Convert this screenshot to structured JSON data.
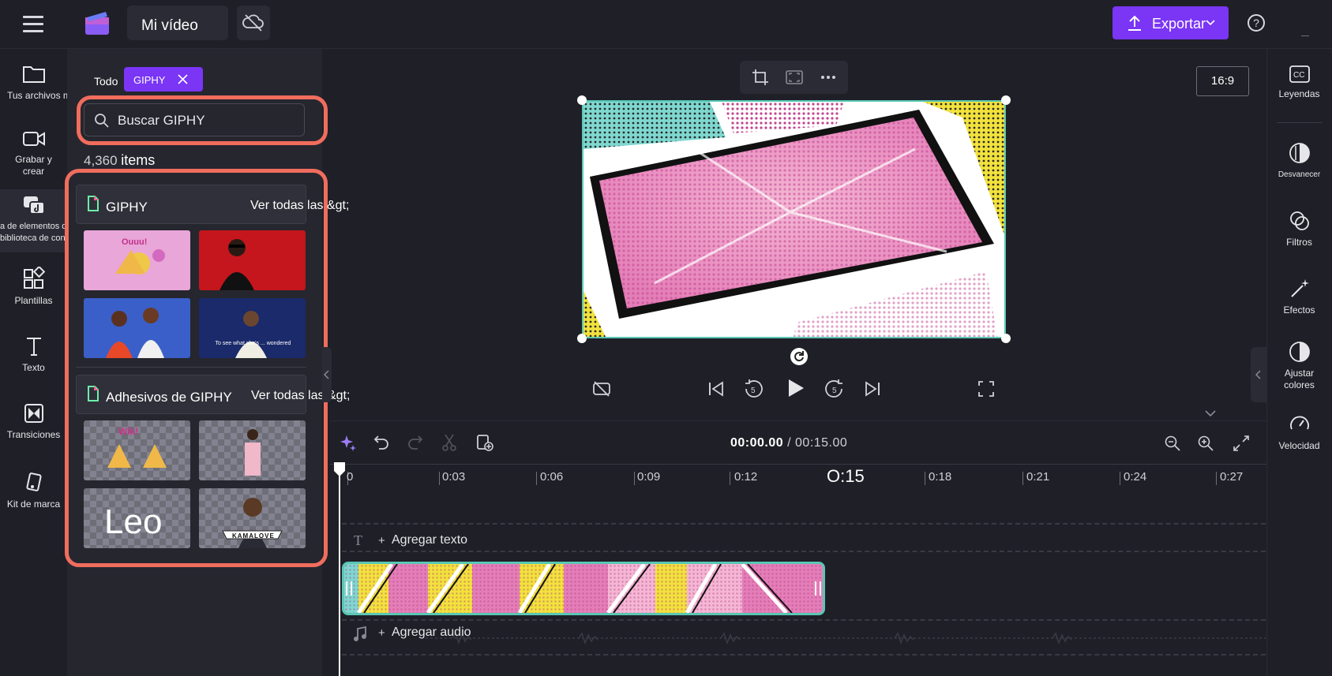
{
  "header": {
    "project_title": "Mi vídeo",
    "export_label": "Exportar",
    "help_label": "?"
  },
  "left_rail": {
    "items": [
      {
        "label": "Tus archivos multimedia",
        "icon": "folder-icon"
      },
      {
        "label": "Grabar y crear",
        "icon": "video-camera-icon"
      },
      {
        "label": "a de elementos de biblioteca de contenido",
        "icon": "content-library-icon"
      },
      {
        "label": "Plantillas",
        "icon": "templates-icon"
      },
      {
        "label": "Texto",
        "icon": "text-icon"
      },
      {
        "label": "Transiciones",
        "icon": "transitions-icon"
      },
      {
        "label": "Kit de marca",
        "icon": "brand-kit-icon"
      }
    ]
  },
  "panel": {
    "filter_all": "Todo",
    "filter_chip": "GIPHY",
    "search_placeholder": "Buscar GIPHY",
    "count_number": "4,360",
    "count_label": "items",
    "sections": [
      {
        "title": "GIPHY",
        "link": "Ver todas las &gt;"
      },
      {
        "title": "Adhesivos de GIPHY",
        "link": "Ver todas las &gt;"
      }
    ],
    "sticker_text": "Leo",
    "sticker_banner": "KAMALOVE",
    "gif_caption": "To see what she's ... wondered"
  },
  "preview": {
    "aspect_ratio": "16:9"
  },
  "timeline": {
    "current_time": "00:00.00",
    "total_time": "/ 00:15.00",
    "ruler_labels": [
      "0",
      "0:03",
      "0:06",
      "0:09",
      "0:12",
      "O:15",
      "0:18",
      "0:21",
      "0:24",
      "0:27"
    ],
    "add_text": "Agregar texto",
    "add_audio": "Agregar audio",
    "plus": "+"
  },
  "right_rail": {
    "items": [
      {
        "label": "Leyendas",
        "icon": "captions-icon"
      },
      {
        "label": "Desvanecer",
        "icon": "fade-icon"
      },
      {
        "label": "Filtros",
        "icon": "filters-icon"
      },
      {
        "label": "Efectos",
        "icon": "effects-wand-icon"
      },
      {
        "label": "Ajustar colores",
        "icon": "adjust-colors-icon"
      },
      {
        "label": "Velocidad",
        "icon": "speed-icon"
      }
    ]
  },
  "colors": {
    "accent": "#7a35f5",
    "highlight": "#f06d5d",
    "selection": "#59c7b4",
    "background": "#1f1f27"
  }
}
